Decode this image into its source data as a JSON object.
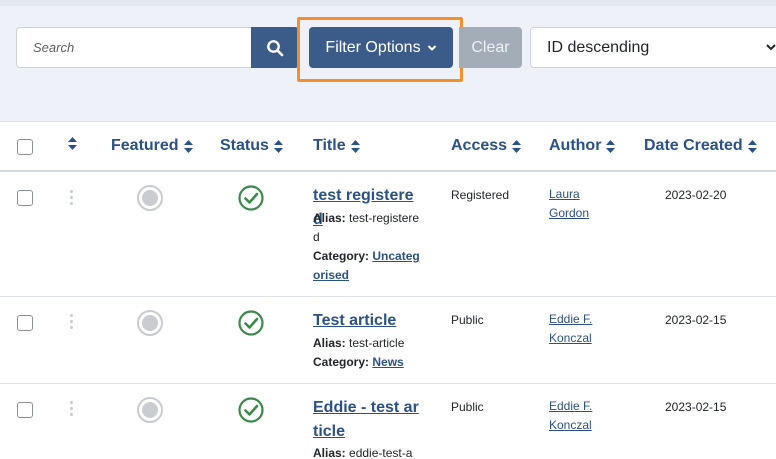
{
  "toolbar": {
    "search_placeholder": "Search",
    "filter_label": "Filter Options",
    "clear_label": "Clear",
    "sort_value": "ID descending"
  },
  "columns": {
    "featured": "Featured",
    "status": "Status",
    "title": "Title",
    "access": "Access",
    "author": "Author",
    "date_created": "Date Created"
  },
  "rows": [
    {
      "title": "test registered",
      "alias_label": "Alias:",
      "alias": "test-registered",
      "category_label": "Category:",
      "category": "Uncategorised",
      "access": "Registered",
      "author": "Laura Gordon",
      "date": "2023-02-20"
    },
    {
      "title": "Test article",
      "alias_label": "Alias:",
      "alias": "test-article",
      "category_label": "Category:",
      "category": "News",
      "access": "Public",
      "author": "Eddie F. Konczal",
      "date": "2023-02-15"
    },
    {
      "title": "Eddie - test article",
      "alias_label": "Alias:",
      "alias": "eddie-test-a",
      "category_label": "",
      "category": "",
      "access": "Public",
      "author": "Eddie F. Konczal",
      "date": "2023-02-15"
    }
  ],
  "icons": {
    "search": "search-icon",
    "chevron": "chevron-down-icon",
    "sort": "sort-icon",
    "status": "published-check-icon",
    "featured": "unfeatured-circle-icon"
  },
  "colors": {
    "primary": "#3b5b88",
    "link": "#2a5286",
    "highlight": "#f3902b",
    "clear_disabled": "#a3adb8",
    "published_green": "#3c8a4b"
  }
}
